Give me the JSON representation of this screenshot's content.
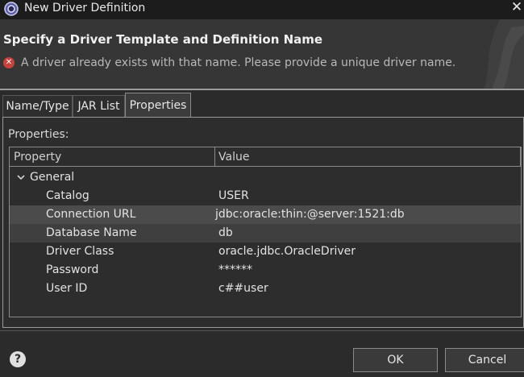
{
  "window": {
    "title": "New Driver Definition",
    "close_glyph": "✕"
  },
  "header": {
    "title": "Specify a Driver Template and Definition Name",
    "error_icon": "error-icon",
    "error_message": "A driver already exists with that name. Please provide a unique driver name."
  },
  "tabs": [
    {
      "label": "Name/Type",
      "active": false
    },
    {
      "label": "JAR List",
      "active": false
    },
    {
      "label": "Properties",
      "active": true
    }
  ],
  "properties_panel": {
    "label": "Properties:",
    "columns": [
      "Property",
      "Value"
    ],
    "group": "General",
    "rows": [
      {
        "property": "Catalog",
        "value": "USER"
      },
      {
        "property": "Connection URL",
        "value": "jdbc:oracle:thin:@server:1521:db"
      },
      {
        "property": "Database Name",
        "value": "db"
      },
      {
        "property": "Driver Class",
        "value": "oracle.jdbc.OracleDriver"
      },
      {
        "property": "Password",
        "value": "******"
      },
      {
        "property": "User ID",
        "value": "c##user"
      }
    ]
  },
  "footer": {
    "help_glyph": "?",
    "ok_label": "OK",
    "cancel_label": "Cancel"
  }
}
